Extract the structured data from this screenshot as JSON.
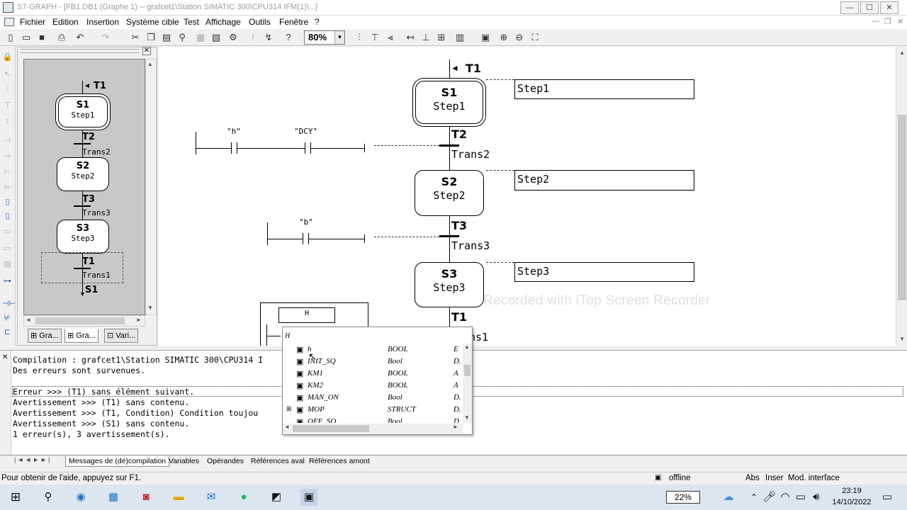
{
  "window": {
    "title": "S7-GRAPH - [FB1.DB1 (Graphe 1) -- grafcet1\\Station SIMATIC 300\\CPU314 IFM(1)\\...]",
    "minimize": "—",
    "maximize": "☐",
    "close": "✕"
  },
  "menu": [
    "Fichier",
    "Edition",
    "Insertion",
    "Système cible",
    "Test",
    "Affichage",
    "Outils",
    "Fenêtre",
    "?"
  ],
  "toolbar": {
    "zoom": "80%"
  },
  "nav": {
    "steps": [
      {
        "name": "S1",
        "comment": "Step1"
      },
      {
        "name": "S2",
        "comment": "Step2"
      },
      {
        "name": "S3",
        "comment": "Step3"
      }
    ],
    "transitions": [
      {
        "name": "T2",
        "comment": "Trans2"
      },
      {
        "name": "T3",
        "comment": "Trans3"
      },
      {
        "name": "T1",
        "comment": "Trans1"
      }
    ],
    "jump_in": "T1",
    "jump_out": "S1",
    "tabs": [
      "Gra...",
      "Gra...",
      "Vari..."
    ]
  },
  "graph": {
    "jump_in": "T1",
    "steps": [
      {
        "name": "S1",
        "comment": "Step1",
        "action": "Step1"
      },
      {
        "name": "S2",
        "comment": "Step2",
        "action": "Step2"
      },
      {
        "name": "S3",
        "comment": "Step3",
        "action": "Step3"
      }
    ],
    "transitions": [
      {
        "name": "T2",
        "comment": "Trans2"
      },
      {
        "name": "T3",
        "comment": "Trans3"
      },
      {
        "name": "T1",
        "comment": "ns1"
      }
    ],
    "contacts": {
      "t2_a": "\"h\"",
      "t2_b": "\"DCY\"",
      "t3_a": "\"b\"",
      "t1_input": "H"
    },
    "watermark": "Recorded with iTop Screen Recorder"
  },
  "autocomplete": {
    "typed": "H",
    "rows": [
      {
        "name": "h",
        "type": "BOOL",
        "scope": "E"
      },
      {
        "name": "INIT_SQ",
        "type": "Bool",
        "scope": "D."
      },
      {
        "name": "KM1",
        "type": "BOOL",
        "scope": "A"
      },
      {
        "name": "KM2",
        "type": "BOOL",
        "scope": "A"
      },
      {
        "name": "MAN_ON",
        "type": "Bool",
        "scope": "D."
      },
      {
        "name": "MOP",
        "type": "STRUCT",
        "scope": "D."
      },
      {
        "name": "OFF_SQ",
        "type": "Bool",
        "scope": "D"
      }
    ]
  },
  "output": {
    "lines": [
      "Compilation : grafcet1\\Station SIMATIC 300\\CPU314 I",
      "Des erreurs sont survenues.",
      "",
      "Erreur >>> (T1)  sans élément suivant.",
      "Avertissement >>> (T1)  sans contenu.",
      "Avertissement >>> (T1, Condition)  Condition toujou",
      "Avertissement >>> (S1)  sans contenu.",
      "1 erreur(s), 3 avertissement(s)."
    ]
  },
  "bottom_tabs": [
    "Messages de (dé)compilation",
    "Variables",
    "Opérandes",
    "Références aval",
    "Références amont"
  ],
  "status": {
    "help": "Pour obtenir de l'aide, appuyez sur F1.",
    "mode": "offline",
    "abs": "Abs",
    "insert": "Inser",
    "modif": "Mod. interface"
  },
  "taskbar": {
    "battery": "22%",
    "time": "23:19",
    "date": "14/10/2022"
  }
}
